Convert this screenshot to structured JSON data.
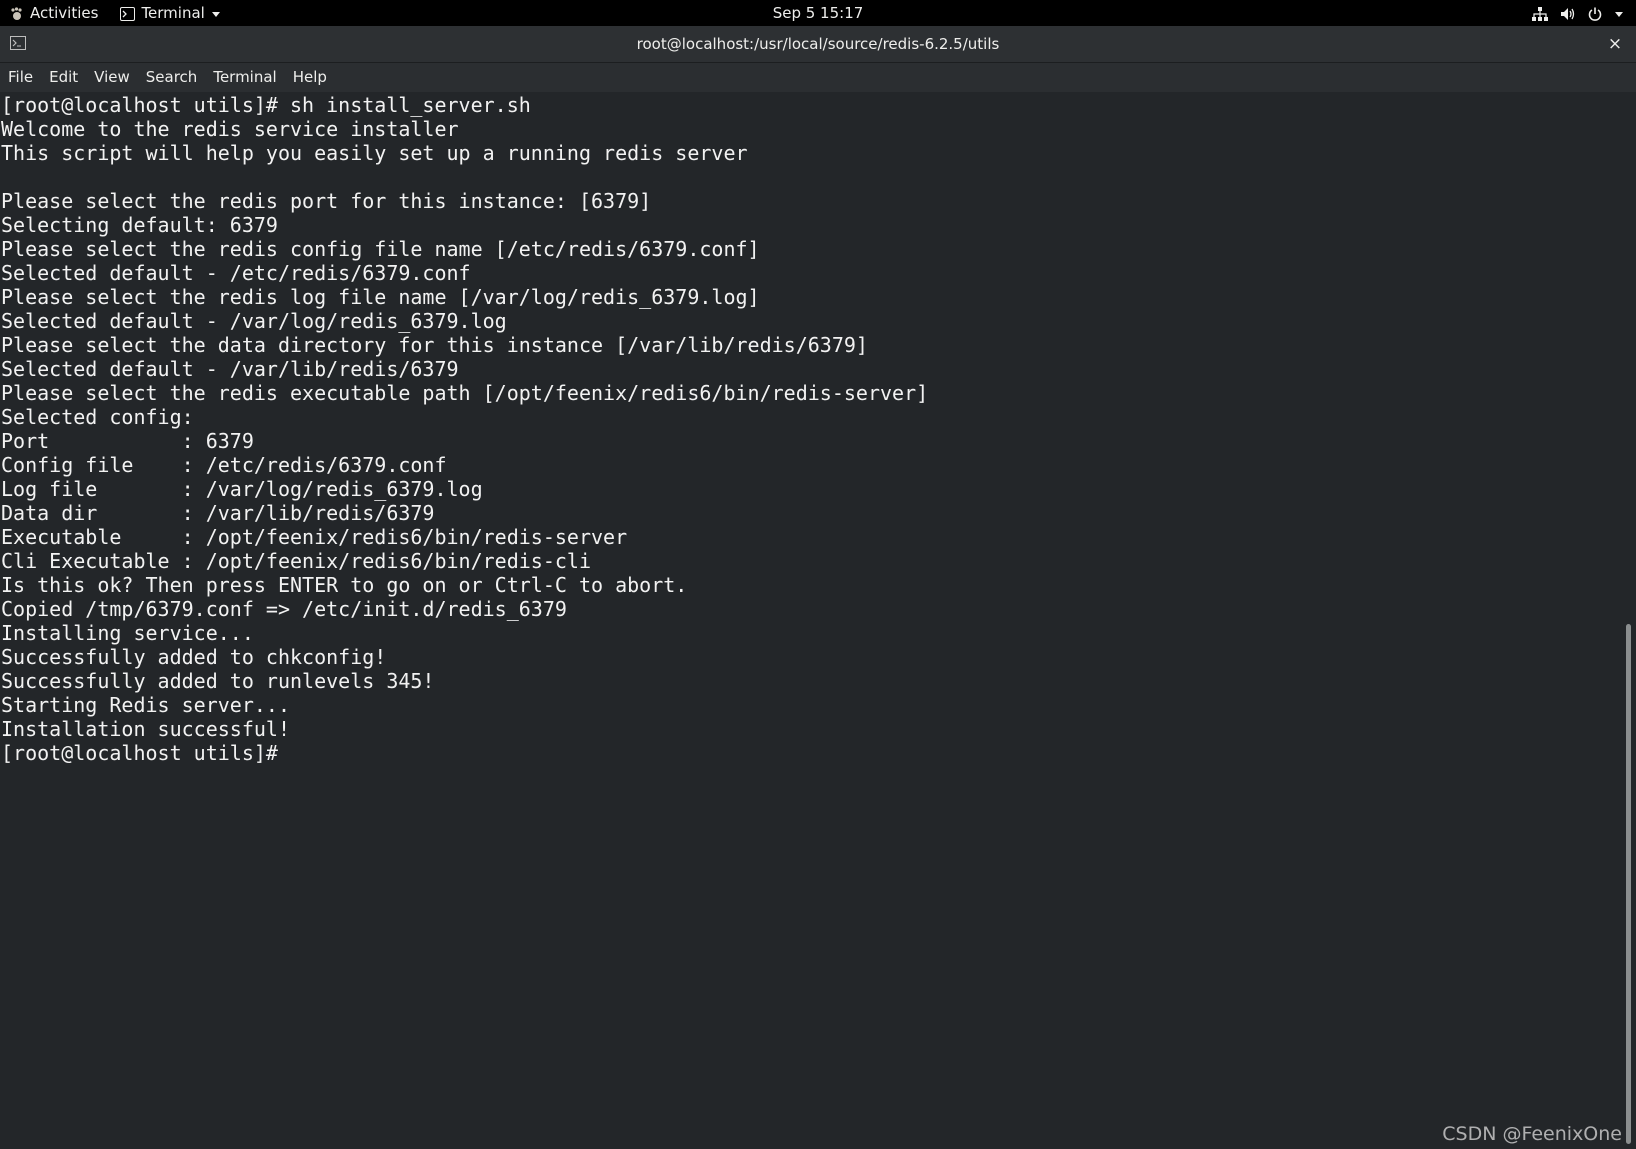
{
  "topbar": {
    "activities": "Activities",
    "app_name": "Terminal",
    "clock": "Sep 5  15:17",
    "icons": [
      "network-icon",
      "volume-icon",
      "power-icon",
      "chevron-down-icon"
    ]
  },
  "window": {
    "title": "root@localhost:/usr/local/source/redis-6.2.5/utils",
    "close_label": "×"
  },
  "menu": {
    "items": [
      "File",
      "Edit",
      "View",
      "Search",
      "Terminal",
      "Help"
    ]
  },
  "terminal": {
    "lines": [
      "[root@localhost utils]# sh install_server.sh",
      "Welcome to the redis service installer",
      "This script will help you easily set up a running redis server",
      "",
      "Please select the redis port for this instance: [6379]",
      "Selecting default: 6379",
      "Please select the redis config file name [/etc/redis/6379.conf]",
      "Selected default - /etc/redis/6379.conf",
      "Please select the redis log file name [/var/log/redis_6379.log]",
      "Selected default - /var/log/redis_6379.log",
      "Please select the data directory for this instance [/var/lib/redis/6379]",
      "Selected default - /var/lib/redis/6379",
      "Please select the redis executable path [/opt/feenix/redis6/bin/redis-server]",
      "Selected config:",
      "Port           : 6379",
      "Config file    : /etc/redis/6379.conf",
      "Log file       : /var/log/redis_6379.log",
      "Data dir       : /var/lib/redis/6379",
      "Executable     : /opt/feenix/redis6/bin/redis-server",
      "Cli Executable : /opt/feenix/redis6/bin/redis-cli",
      "Is this ok? Then press ENTER to go on or Ctrl-C to abort.",
      "Copied /tmp/6379.conf => /etc/init.d/redis_6379",
      "Installing service...",
      "Successfully added to chkconfig!",
      "Successfully added to runlevels 345!",
      "Starting Redis server...",
      "Installation successful!",
      "[root@localhost utils]# "
    ]
  },
  "watermark": "CSDN @FeenixOne"
}
